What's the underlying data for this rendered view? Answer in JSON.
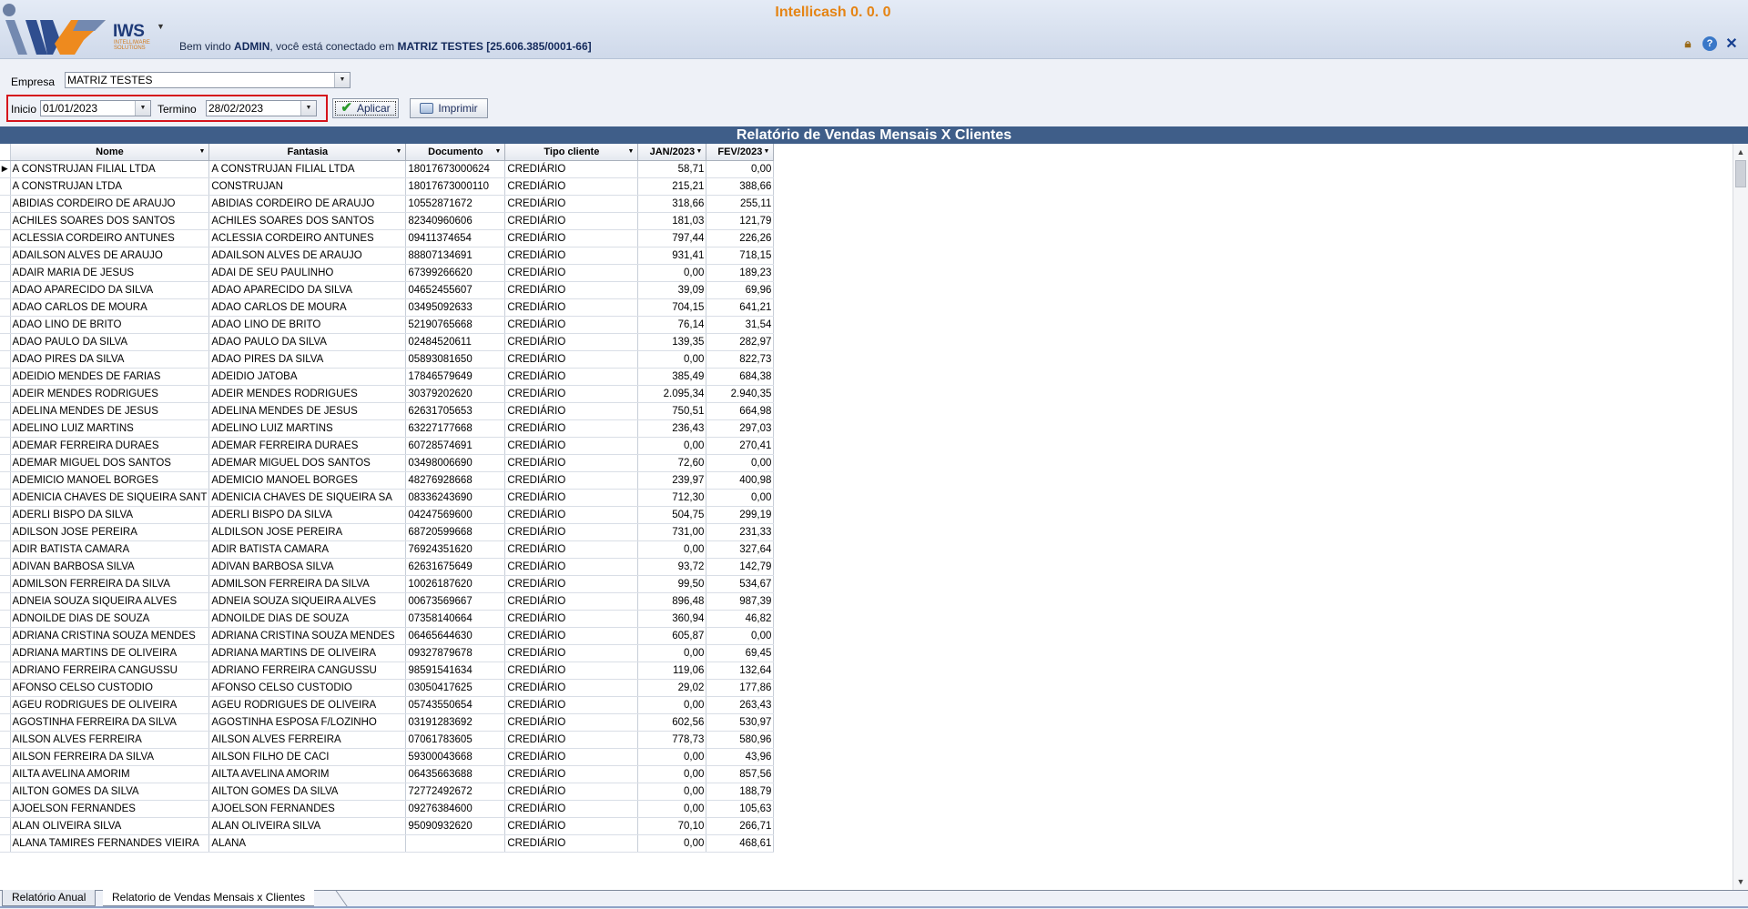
{
  "app": {
    "title": "Intellicash 0. 0.  0",
    "logo_text": "IWS",
    "logo_subtitle": "INTELLIWARE SOLUTIONS",
    "welcome_prefix": "Bem vindo ",
    "user": "ADMIN",
    "welcome_mid": ", você está conectado em ",
    "company_connected": "MATRIZ TESTES [25.606.385/0001-66]"
  },
  "filters": {
    "empresa_label": "Empresa",
    "empresa_value": "MATRIZ TESTES",
    "inicio_label": "Inicio",
    "inicio_value": "01/01/2023",
    "termino_label": "Termino",
    "termino_value": "28/02/2023",
    "apply_label": "Aplicar",
    "print_label": "Imprimir"
  },
  "report": {
    "title": "Relatório de Vendas Mensais X Clientes",
    "columns": [
      "Nome",
      "Fantasia",
      "Documento",
      "Tipo cliente",
      "JAN/2023",
      "FEV/2023"
    ],
    "rows": [
      [
        "A CONSTRUJAN FILIAL LTDA",
        "A CONSTRUJAN FILIAL LTDA",
        "18017673000624",
        "CREDIÁRIO",
        "58,71",
        "0,00"
      ],
      [
        "A CONSTRUJAN LTDA",
        "CONSTRUJAN",
        "18017673000110",
        "CREDIÁRIO",
        "215,21",
        "388,66"
      ],
      [
        "ABIDIAS CORDEIRO DE ARAUJO",
        "ABIDIAS CORDEIRO DE ARAUJO",
        "10552871672",
        "CREDIÁRIO",
        "318,66",
        "255,11"
      ],
      [
        "ACHILES SOARES DOS SANTOS",
        "ACHILES SOARES DOS SANTOS",
        "82340960606",
        "CREDIÁRIO",
        "181,03",
        "121,79"
      ],
      [
        "ACLESSIA CORDEIRO ANTUNES",
        "ACLESSIA CORDEIRO ANTUNES",
        "09411374654",
        "CREDIÁRIO",
        "797,44",
        "226,26"
      ],
      [
        "ADAILSON ALVES DE ARAUJO",
        "ADAILSON ALVES DE ARAUJO",
        "88807134691",
        "CREDIÁRIO",
        "931,41",
        "718,15"
      ],
      [
        "ADAIR MARIA DE JESUS",
        "ADAI DE SEU PAULINHO",
        "67399266620",
        "CREDIÁRIO",
        "0,00",
        "189,23"
      ],
      [
        "ADAO APARECIDO DA SILVA",
        "ADAO APARECIDO DA SILVA",
        "04652455607",
        "CREDIÁRIO",
        "39,09",
        "69,96"
      ],
      [
        "ADAO CARLOS DE MOURA",
        "ADAO CARLOS DE MOURA",
        "03495092633",
        "CREDIÁRIO",
        "704,15",
        "641,21"
      ],
      [
        "ADAO LINO DE BRITO",
        "ADAO LINO DE BRITO",
        "52190765668",
        "CREDIÁRIO",
        "76,14",
        "31,54"
      ],
      [
        "ADAO PAULO DA SILVA",
        "ADAO PAULO DA SILVA",
        "02484520611",
        "CREDIÁRIO",
        "139,35",
        "282,97"
      ],
      [
        "ADAO PIRES DA SILVA",
        "ADAO PIRES DA SILVA",
        "05893081650",
        "CREDIÁRIO",
        "0,00",
        "822,73"
      ],
      [
        "ADEIDIO MENDES DE FARIAS",
        "ADEIDIO JATOBA",
        "17846579649",
        "CREDIÁRIO",
        "385,49",
        "684,38"
      ],
      [
        "ADEIR MENDES RODRIGUES",
        "ADEIR MENDES RODRIGUES",
        "30379202620",
        "CREDIÁRIO",
        "2.095,34",
        "2.940,35"
      ],
      [
        "ADELINA MENDES DE JESUS",
        "ADELINA MENDES DE JESUS",
        "62631705653",
        "CREDIÁRIO",
        "750,51",
        "664,98"
      ],
      [
        "ADELINO LUIZ MARTINS",
        "ADELINO LUIZ MARTINS",
        "63227177668",
        "CREDIÁRIO",
        "236,43",
        "297,03"
      ],
      [
        "ADEMAR FERREIRA DURAES",
        "ADEMAR FERREIRA DURAES",
        "60728574691",
        "CREDIÁRIO",
        "0,00",
        "270,41"
      ],
      [
        "ADEMAR MIGUEL DOS SANTOS",
        "ADEMAR MIGUEL DOS SANTOS",
        "03498006690",
        "CREDIÁRIO",
        "72,60",
        "0,00"
      ],
      [
        "ADEMICIO MANOEL BORGES",
        "ADEMICIO MANOEL BORGES",
        "48276928668",
        "CREDIÁRIO",
        "239,97",
        "400,98"
      ],
      [
        "ADENICIA CHAVES DE SIQUEIRA SANT",
        "ADENICIA CHAVES DE SIQUEIRA SA",
        "08336243690",
        "CREDIÁRIO",
        "712,30",
        "0,00"
      ],
      [
        "ADERLI BISPO DA SILVA",
        "ADERLI BISPO DA SILVA",
        "04247569600",
        "CREDIÁRIO",
        "504,75",
        "299,19"
      ],
      [
        "ADILSON JOSE PEREIRA",
        "ALDILSON JOSE PEREIRA",
        "68720599668",
        "CREDIÁRIO",
        "731,00",
        "231,33"
      ],
      [
        "ADIR BATISTA CAMARA",
        "ADIR BATISTA CAMARA",
        "76924351620",
        "CREDIÁRIO",
        "0,00",
        "327,64"
      ],
      [
        "ADIVAN BARBOSA SILVA",
        "ADIVAN BARBOSA SILVA",
        "62631675649",
        "CREDIÁRIO",
        "93,72",
        "142,79"
      ],
      [
        "ADMILSON FERREIRA DA SILVA",
        "ADMILSON FERREIRA DA SILVA",
        "10026187620",
        "CREDIÁRIO",
        "99,50",
        "534,67"
      ],
      [
        "ADNEIA SOUZA SIQUEIRA ALVES",
        "ADNEIA SOUZA SIQUEIRA ALVES",
        "00673569667",
        "CREDIÁRIO",
        "896,48",
        "987,39"
      ],
      [
        "ADNOILDE DIAS DE SOUZA",
        "ADNOILDE DIAS DE SOUZA",
        "07358140664",
        "CREDIÁRIO",
        "360,94",
        "46,82"
      ],
      [
        "ADRIANA CRISTINA SOUZA MENDES",
        "ADRIANA CRISTINA SOUZA MENDES",
        "06465644630",
        "CREDIÁRIO",
        "605,87",
        "0,00"
      ],
      [
        "ADRIANA MARTINS DE OLIVEIRA",
        "ADRIANA MARTINS DE OLIVEIRA",
        "09327879678",
        "CREDIÁRIO",
        "0,00",
        "69,45"
      ],
      [
        "ADRIANO FERREIRA CANGUSSU",
        "ADRIANO FERREIRA CANGUSSU",
        "98591541634",
        "CREDIÁRIO",
        "119,06",
        "132,64"
      ],
      [
        "AFONSO CELSO CUSTODIO",
        "AFONSO CELSO CUSTODIO",
        "03050417625",
        "CREDIÁRIO",
        "29,02",
        "177,86"
      ],
      [
        "AGEU RODRIGUES DE OLIVEIRA",
        "AGEU RODRIGUES DE OLIVEIRA",
        "05743550654",
        "CREDIÁRIO",
        "0,00",
        "263,43"
      ],
      [
        "AGOSTINHA FERREIRA DA SILVA",
        "AGOSTINHA ESPOSA F/LOZINHO",
        "03191283692",
        "CREDIÁRIO",
        "602,56",
        "530,97"
      ],
      [
        "AILSON ALVES FERREIRA",
        "AILSON ALVES FERREIRA",
        "07061783605",
        "CREDIÁRIO",
        "778,73",
        "580,96"
      ],
      [
        "AILSON FERREIRA DA SILVA",
        "AILSON FILHO DE CACI",
        "59300043668",
        "CREDIÁRIO",
        "0,00",
        "43,96"
      ],
      [
        "AILTA AVELINA AMORIM",
        "AILTA AVELINA AMORIM",
        "06435663688",
        "CREDIÁRIO",
        "0,00",
        "857,56"
      ],
      [
        "AILTON GOMES DA SILVA",
        "AILTON GOMES DA SILVA",
        "72772492672",
        "CREDIÁRIO",
        "0,00",
        "188,79"
      ],
      [
        "AJOELSON FERNANDES",
        "AJOELSON FERNANDES",
        "09276384600",
        "CREDIÁRIO",
        "0,00",
        "105,63"
      ],
      [
        "ALAN OLIVEIRA SILVA",
        "ALAN OLIVEIRA SILVA",
        "95090932620",
        "CREDIÁRIO",
        "70,10",
        "266,71"
      ],
      [
        "ALANA TAMIRES FERNANDES VIEIRA",
        "ALANA",
        "",
        "CREDIÁRIO",
        "0,00",
        "468,61"
      ]
    ]
  },
  "tabs": [
    "Relatório Anual",
    "Relatorio de Vendas Mensais x Clientes"
  ],
  "icons": {
    "lock": "lock-icon",
    "help": "help-icon",
    "close": "close-icon"
  }
}
